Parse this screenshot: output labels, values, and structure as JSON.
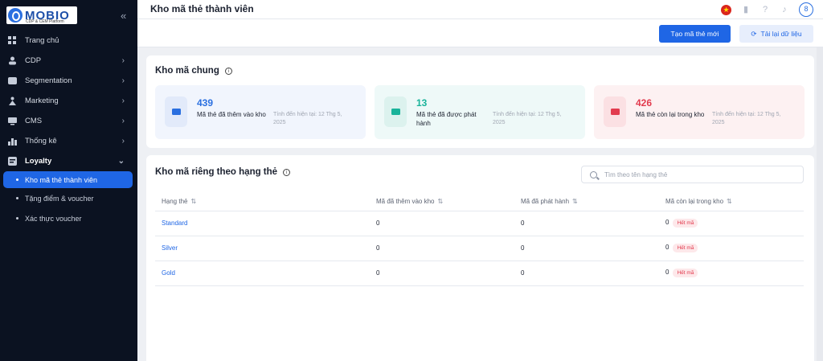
{
  "sidebar": {
    "logo_text": "MOBIO",
    "logo_sub": "CDP & CEM Platform",
    "collapse_icon": "«",
    "items": [
      {
        "label": "Trang chủ",
        "icon": "grid-icon",
        "has_children": false
      },
      {
        "label": "CDP",
        "icon": "user-icon",
        "has_children": true
      },
      {
        "label": "Segmentation",
        "icon": "segment-icon",
        "has_children": true
      },
      {
        "label": "Marketing",
        "icon": "marketing-icon",
        "has_children": true
      },
      {
        "label": "CMS",
        "icon": "cms-icon",
        "has_children": true
      },
      {
        "label": "Thống kê",
        "icon": "chart-icon",
        "has_children": true
      },
      {
        "label": "Loyalty",
        "icon": "loyalty-icon",
        "has_children": true,
        "open": true
      }
    ],
    "loyalty_sub": [
      {
        "label": "Kho mã thẻ thành viên",
        "active": true
      },
      {
        "label": "Tặng điểm & voucher",
        "active": false
      },
      {
        "label": "Xác thực voucher",
        "active": false
      }
    ]
  },
  "header": {
    "title": "Kho mã thẻ thành viên",
    "icons": [
      "vn-flag-icon",
      "book-icon",
      "help-icon",
      "bell-icon",
      "avatar-icon"
    ]
  },
  "actions": {
    "create_label": "Tạo mã thẻ mới",
    "reload_label": "Tải lại dữ liệu"
  },
  "common": {
    "title": "Kho mã chung",
    "stats": [
      {
        "value": "439",
        "label": "Mã thẻ đã thêm vào kho",
        "updated": "Tính đến hiện tại: 12 Thg 5, 2025",
        "color": "#2a6fe0",
        "bg": "#f1f5fd",
        "icon_bg": "#e2eafa"
      },
      {
        "value": "13",
        "label": "Mã thẻ đã được phát hành",
        "updated": "Tính đến hiện tại: 12 Thg 5, 2025",
        "color": "#19b39a",
        "bg": "#eef9f8",
        "icon_bg": "#dcf2ee"
      },
      {
        "value": "426",
        "label": "Mã thẻ còn lại trong kho",
        "updated": "Tính đến hiện tại: 12 Thg 5, 2025",
        "color": "#e23b4e",
        "bg": "#fdf1f2",
        "icon_bg": "#fbe0e3"
      }
    ]
  },
  "private": {
    "title": "Kho mã riêng theo hạng thẻ",
    "search_placeholder": "Tìm theo tên hạng thẻ",
    "columns": [
      "Hạng thẻ",
      "Mã đã thêm vào kho",
      "Mã đã phát hành",
      "Mã còn lại trong kho"
    ],
    "rows": [
      {
        "tier": "Standard",
        "added": "0",
        "issued": "0",
        "remaining": "0",
        "badge": "Hết mã"
      },
      {
        "tier": "Silver",
        "added": "0",
        "issued": "0",
        "remaining": "0",
        "badge": "Hết mã"
      },
      {
        "tier": "Gold",
        "added": "0",
        "issued": "0",
        "remaining": "0",
        "badge": "Hết mã"
      }
    ]
  }
}
